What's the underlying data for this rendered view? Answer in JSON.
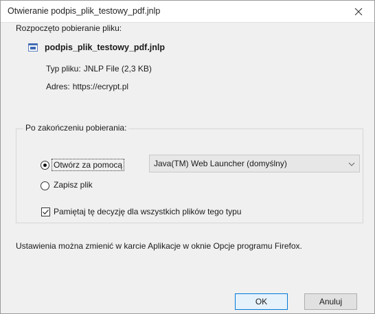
{
  "window": {
    "title": "Otwieranie podpis_plik_testowy_pdf.jnlp"
  },
  "download": {
    "heading": "Rozpoczęto pobieranie pliku:",
    "file_name": "podpis_plik_testowy_pdf.jnlp",
    "type_label": "Typ pliku:",
    "type_value": "JNLP File (2,3 KB)",
    "address_label": "Adres:",
    "address_value": "https://ecrypt.pl"
  },
  "after_download": {
    "legend": "Po zakończeniu pobierania:",
    "open_with_label": "Otwórz za pomocą",
    "open_with_selected": true,
    "app_select_value": "Java(TM) Web Launcher (domyślny)",
    "save_file_label": "Zapisz plik",
    "save_file_selected": false,
    "remember_label": "Pamiętaj tę decyzję dla wszystkich plików tego typu",
    "remember_checked": true
  },
  "info_text": "Ustawienia można zmienić w karcie Aplikacje w oknie Opcje programu Firefox.",
  "buttons": {
    "ok": "OK",
    "cancel": "Anuluj"
  },
  "icons": {
    "close": "close-icon",
    "file": "jnlp-file-icon",
    "dropdown": "chevron-down-icon",
    "check": "checkmark-icon"
  },
  "colors": {
    "dialog_bg": "#f0f0f0",
    "titlebar_bg": "#ffffff",
    "ok_border": "#0078d7"
  }
}
